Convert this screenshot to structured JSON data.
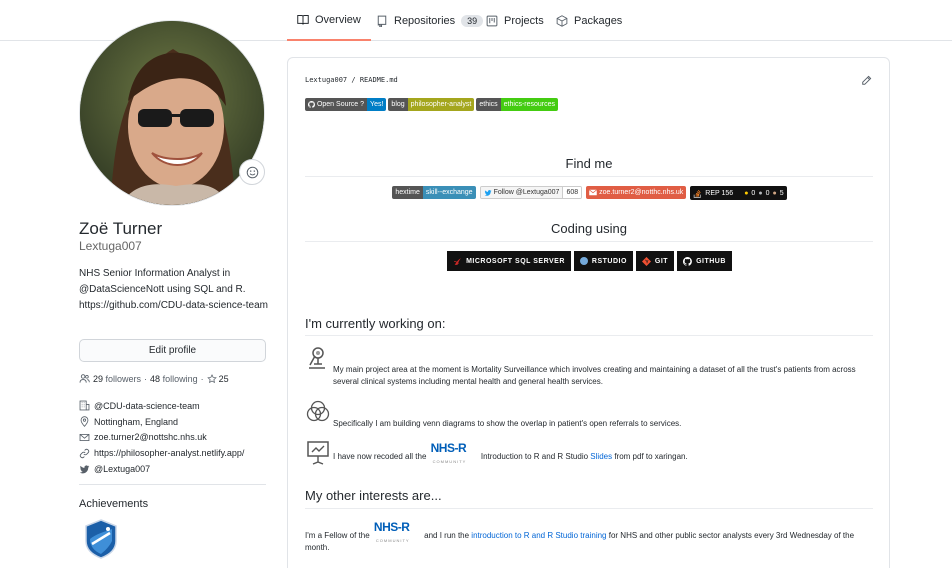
{
  "tabs": [
    {
      "label": "Overview",
      "icon": "book-icon"
    },
    {
      "label": "Repositories",
      "icon": "repo-icon",
      "count": "39"
    },
    {
      "label": "Projects",
      "icon": "project-icon"
    },
    {
      "label": "Packages",
      "icon": "package-icon"
    }
  ],
  "profile": {
    "full_name": "Zoë Turner",
    "username": "Lextuga007",
    "bio": "NHS Senior Information Analyst in @DataScienceNott using SQL and R. https://github.com/CDU-data-science-team",
    "edit_label": "Edit profile",
    "followers": "29",
    "followers_label": "followers",
    "following": "48",
    "following_label": "following",
    "stars": "25",
    "org": "@CDU-data-science-team",
    "location": "Nottingham, England",
    "email": "zoe.turner2@nottshc.nhs.uk",
    "website": "https://philosopher-analyst.netlify.app/",
    "twitter": "@Lextuga007",
    "achievements_title": "Achievements"
  },
  "readme": {
    "owner": "Lextuga007",
    "sep": "/",
    "file": "README.md",
    "top_shields": [
      {
        "left": "Open Source ?",
        "right": "Yes!",
        "color": "#007ec6"
      },
      {
        "left": "blog",
        "right": "philosopher-analyst",
        "color": "#a4a61d"
      },
      {
        "left": "ethics",
        "right": "ethics-resources",
        "color": "#4c1"
      }
    ],
    "find_me": "Find me",
    "find_shields": {
      "hextime_left": "hextime",
      "hextime_right": "skill--exchange",
      "twitter": "Follow @Lextuga007",
      "twitter_count": "608",
      "email": "zoe.turner2@notthc.nhs.uk",
      "rep_label": "REP 156",
      "gold": "0",
      "silver": "0",
      "bronze": "5"
    },
    "coding_using": "Coding using",
    "coding_badges": [
      "MICROSOFT SQL SERVER",
      "RSTUDIO",
      "GIT",
      "GITHUB"
    ],
    "working_on": "I'm currently working on:",
    "para1": "My main project area at the moment is Mortality Surveillance which involves creating and maintaining a dataset of all the trust's patients from across several clinical systems including mental health and general health services.",
    "para2": "Specifically I am building venn diagrams to show the overlap in patient's open referrals to services.",
    "para3_a": "I have now recoded all the",
    "para3_b": "Introduction to R and R Studio",
    "para3_link": "Slides",
    "para3_c": "from pdf to xaringan.",
    "nhsr_text": "NHS-R",
    "nhsr_sub": "COMMUNITY",
    "other_interests": "My other interests are...",
    "para4_a": "I'm a Fellow of the",
    "para4_b": "and I run the",
    "para4_link": "introduction to R and R Studio training",
    "para4_c": "for NHS and other public sector analysts every 3rd Wednesday of the month."
  },
  "colors": {
    "accent": "#f9826c",
    "link": "#0366d6",
    "border": "#e1e4e8"
  }
}
